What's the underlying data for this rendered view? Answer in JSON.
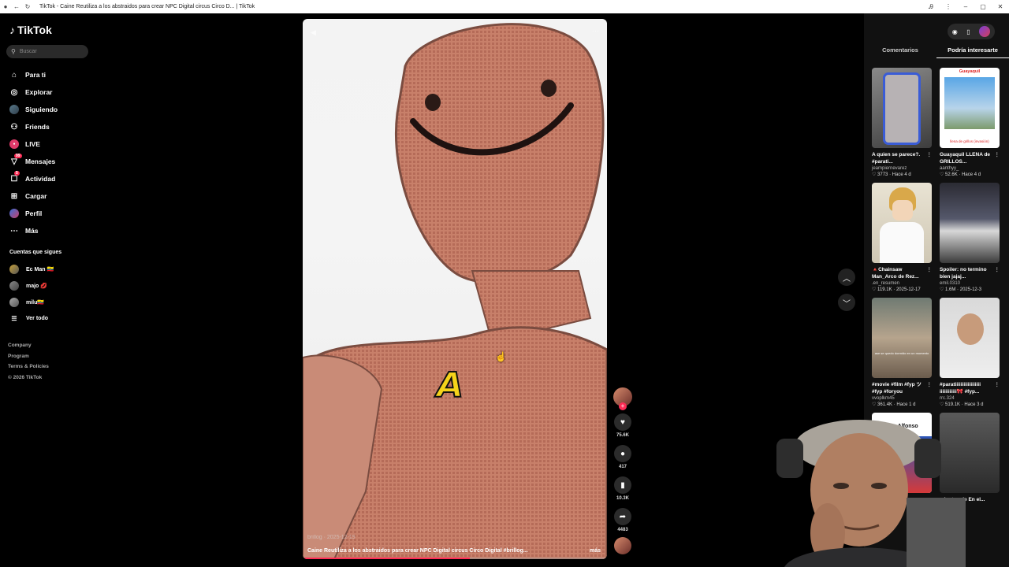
{
  "window": {
    "title": "TikTok - Caine Reutiliza a los abstraidos para crear NPC Digital circus Circo D... | TikTok"
  },
  "sidebar": {
    "logo_text": "TikTok",
    "search_placeholder": "Buscar",
    "nav": [
      {
        "label": "Para ti",
        "icon": "home-icon"
      },
      {
        "label": "Explorar",
        "icon": "compass-icon"
      },
      {
        "label": "Siguiendo",
        "icon": "following-avatar-icon"
      },
      {
        "label": "Friends",
        "icon": "friends-icon"
      },
      {
        "label": "LIVE",
        "icon": "live-icon"
      },
      {
        "label": "Mensajes",
        "icon": "messages-icon",
        "badge": "99"
      },
      {
        "label": "Actividad",
        "icon": "activity-icon",
        "badge": "5"
      },
      {
        "label": "Cargar",
        "icon": "upload-icon"
      },
      {
        "label": "Perfil",
        "icon": "profile-avatar-icon"
      },
      {
        "label": "Más",
        "icon": "more-icon"
      }
    ],
    "following_title": "Cuentas que sigues",
    "following": [
      {
        "name": "Ec Man 🇪🇨"
      },
      {
        "name": "majo 💋"
      },
      {
        "name": "milu🇪🇨"
      }
    ],
    "see_all": "Ver todo",
    "footer": [
      "Company",
      "Program",
      "Terms & Policies",
      "© 2026 TikTok"
    ]
  },
  "video": {
    "username": "brillog · 2025-12-19",
    "caption": "Caine Reutiliza a los abstraidos para crear NPC Digital circus Circo Digital #brillog...",
    "more_label": "más",
    "overlay_letter": "A",
    "progress": 0.55
  },
  "actions": {
    "likes": "75.6K",
    "comments": "417",
    "saves": "10.3K",
    "shares": "4483"
  },
  "right_panel": {
    "tabs": [
      {
        "label": "Comentarios",
        "active": false
      },
      {
        "label": "Podría interesarte",
        "active": true
      }
    ],
    "cards": [
      {
        "title": "A quien se parece?. #parati...",
        "author": "jeampiernevarez",
        "likes": "3773",
        "date": "Hace 4 d"
      },
      {
        "title": "Guayaquil LLENA de GRILLOS...",
        "author": "aanthyy_",
        "likes": "52.6K",
        "date": "Hace 4 d",
        "thumb_top": "Guayaquil",
        "thumb_bottom": "llena de grillos (invasión)"
      },
      {
        "title": "🔺Chainsaw Man_Arco de Rez...",
        "author": ".en_resumen",
        "likes": "119.1K",
        "date": "2025-12-17"
      },
      {
        "title": "Spoiler: no termino bien jajaj...",
        "author": "emil.0310",
        "likes": "1.6M",
        "date": "2025-12-3"
      },
      {
        "title": "#movie #film #fyp ツ #fyp #foryou",
        "author": "vvoplkm45",
        "likes": "361.4K",
        "date": "Hace 1 d",
        "thumb_caption": "ase se quedo dormido en un momento"
      },
      {
        "title": "#paratiiiiiiiiiiiiiiiiii iiiiiiiiiiii🎀 #fyp...",
        "author": "rrc.324",
        "likes": "519.1K",
        "date": "Hace 3 d"
      },
      {
        "title": "",
        "author": "",
        "likes": "",
        "date": "",
        "thumb_title": "Don Alfonso"
      },
      {
        "title": "minutos de En el...",
        "author": "",
        "likes": "",
        "date": ""
      }
    ]
  }
}
